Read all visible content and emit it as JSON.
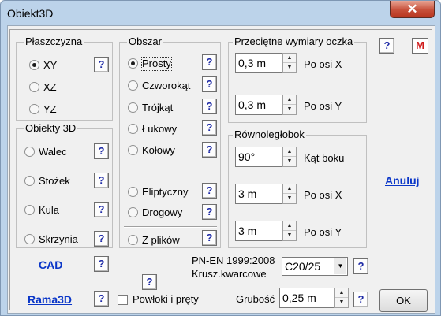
{
  "window": {
    "title": "Obiekt3D",
    "close_glyph": "✕"
  },
  "help_glyph": "?",
  "plaszczyzna": {
    "title": "Płaszczyzna",
    "options": [
      "XY",
      "XZ",
      "YZ"
    ],
    "selected": "XY"
  },
  "obiekty": {
    "title": "Obiekty 3D",
    "options": [
      "Walec",
      "Stożek",
      "Kula",
      "Skrzynia"
    ]
  },
  "obszar": {
    "title": "Obszar",
    "options": [
      "Prosty",
      "Czworokąt",
      "Trójkąt",
      "Łukowy",
      "Kołowy",
      "Eliptyczny",
      "Drogowy",
      "Z plików"
    ],
    "selected": "Prosty"
  },
  "oczko": {
    "title": "Przeciętne wymiary oczka",
    "x_value": "0,3 m",
    "x_label": "Po osi X",
    "y_value": "0,3 m",
    "y_label": "Po osi Y"
  },
  "rownoleglobok": {
    "title": "Równoległobok",
    "angle_value": "90°",
    "angle_label": "Kąt boku",
    "x_value": "3 m",
    "x_label": "Po osi X",
    "y_value": "3 m",
    "y_label": "Po osi Y"
  },
  "links": {
    "cad": "CAD",
    "rama3d": "Rama3D",
    "anuluj": "Anuluj"
  },
  "standard": {
    "line1": "PN-EN 1999:2008",
    "line2": "Krusz.kwarcowe",
    "concrete": "C20/25"
  },
  "powloki": {
    "label": "Powłoki i pręty",
    "checked": false
  },
  "grubosc": {
    "label": "Grubość",
    "value": "0,25 m"
  },
  "buttons": {
    "ok": "OK",
    "m": "M"
  }
}
